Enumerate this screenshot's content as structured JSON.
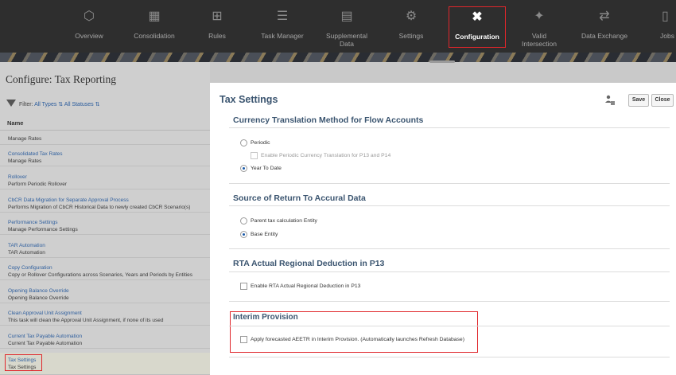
{
  "nav": {
    "items": [
      {
        "label": "Overview",
        "icon": "cube-icon"
      },
      {
        "label": "Consolidation",
        "icon": "chart-icon"
      },
      {
        "label": "Rules",
        "icon": "grid-icon"
      },
      {
        "label": "Task Manager",
        "icon": "checklist-icon"
      },
      {
        "label": "Supplemental",
        "label2": "Data",
        "icon": "table-icon"
      },
      {
        "label": "Settings",
        "icon": "gear-icon"
      },
      {
        "label": "Configuration",
        "icon": "tools-icon"
      },
      {
        "label": "Valid",
        "label2": "Intersection",
        "icon": "intersection-icon"
      },
      {
        "label": "Data Exchange",
        "icon": "exchange-icon"
      },
      {
        "label": "Jobs",
        "icon": "clipboard-icon"
      }
    ],
    "active": "Configuration"
  },
  "left": {
    "title": "Configure: Tax Reporting",
    "filter_label": "Filter:",
    "filter_types": "All Types",
    "filter_statuses": "All Statuses",
    "name_header": "Name",
    "items": [
      {
        "title": "",
        "desc": "Manage Rates"
      },
      {
        "title": "Consolidated Tax Rates",
        "desc": "Manage Rates"
      },
      {
        "title": "Rollover",
        "desc": "Perform Periodic Rollover"
      },
      {
        "title": "CbCR Data Migration for Separate Approval Process",
        "desc": "Performs Migration of CbCR Historical Data to newly created CbCR Scenario(s)"
      },
      {
        "title": "Performance Settings",
        "desc": "Manage Performance Settings"
      },
      {
        "title": "TAR Automation",
        "desc": "TAR Automation"
      },
      {
        "title": "Copy Configuration",
        "desc": "Copy or Rollover Configurations across Scenarios, Years and Periods by Entities"
      },
      {
        "title": "Opening Balance Override",
        "desc": "Opening Balance Override"
      },
      {
        "title": "Clean Approval Unit Assignment",
        "desc": "This task will clean the Approval Unit Assignment, if none of its used"
      },
      {
        "title": "Current Tax Payable Automation",
        "desc": "Current Tax Payable Automation"
      },
      {
        "title": "Tax Settings",
        "desc": "Tax Settings"
      }
    ]
  },
  "right": {
    "title": "Tax Settings",
    "save": "Save",
    "close": "Close",
    "sections": {
      "currency": {
        "title": "Currency Translation Method for Flow Accounts",
        "periodic": "Periodic",
        "enable_periodic": "Enable Periodic Currency Translation for P13 and P14",
        "ytd": "Year To Date",
        "selected": "Year To Date"
      },
      "source": {
        "title": "Source of Return To Accural Data",
        "parent": "Parent tax calculation Entity",
        "base": "Base Entity",
        "selected": "Base Entity"
      },
      "rta": {
        "title": "RTA Actual Regional Deduction in P13",
        "enable": "Enable RTA Actual Regional Deduction in P13"
      },
      "interim": {
        "title": "Interim Provision",
        "apply": "Apply forecasted AEETR in Interim Provision. (Automatically launches Refresh Database)"
      }
    }
  },
  "colors": {
    "accent_title": "#3b5570",
    "highlight_border": "#e0262b",
    "nav_bg": "#2e2e2e",
    "link": "#2f5f9e"
  }
}
